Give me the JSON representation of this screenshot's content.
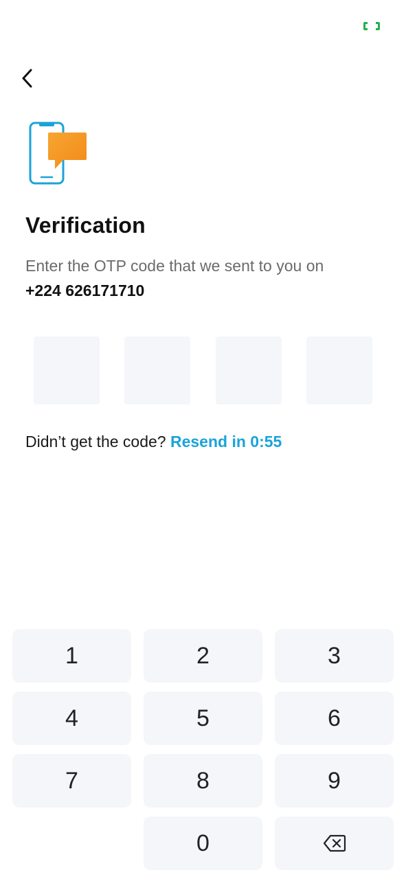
{
  "status": {
    "indicator_icon": "screen-record-icon",
    "indicator_color": "#22b14c"
  },
  "header": {
    "back_icon": "chevron-left-icon"
  },
  "illustration": {
    "icon": "phone-message-icon",
    "phone_color": "#1aa3d9",
    "bubble_color": "#f5961f"
  },
  "title": "Verification",
  "subtitle": "Enter the OTP code that we sent to you on",
  "phone_number": "+224 626171710",
  "otp": {
    "length": 4,
    "values": [
      "",
      "",
      "",
      ""
    ]
  },
  "resend": {
    "prompt": "Didn’t get the code?",
    "link": "Resend in 0:55"
  },
  "keypad": {
    "keys": [
      "1",
      "2",
      "3",
      "4",
      "5",
      "6",
      "7",
      "8",
      "9",
      "0"
    ],
    "backspace_icon": "backspace-icon"
  },
  "colors": {
    "accent": "#1aa3d9",
    "box_bg": "#f4f6f9",
    "muted_text": "#6b6b6b"
  }
}
